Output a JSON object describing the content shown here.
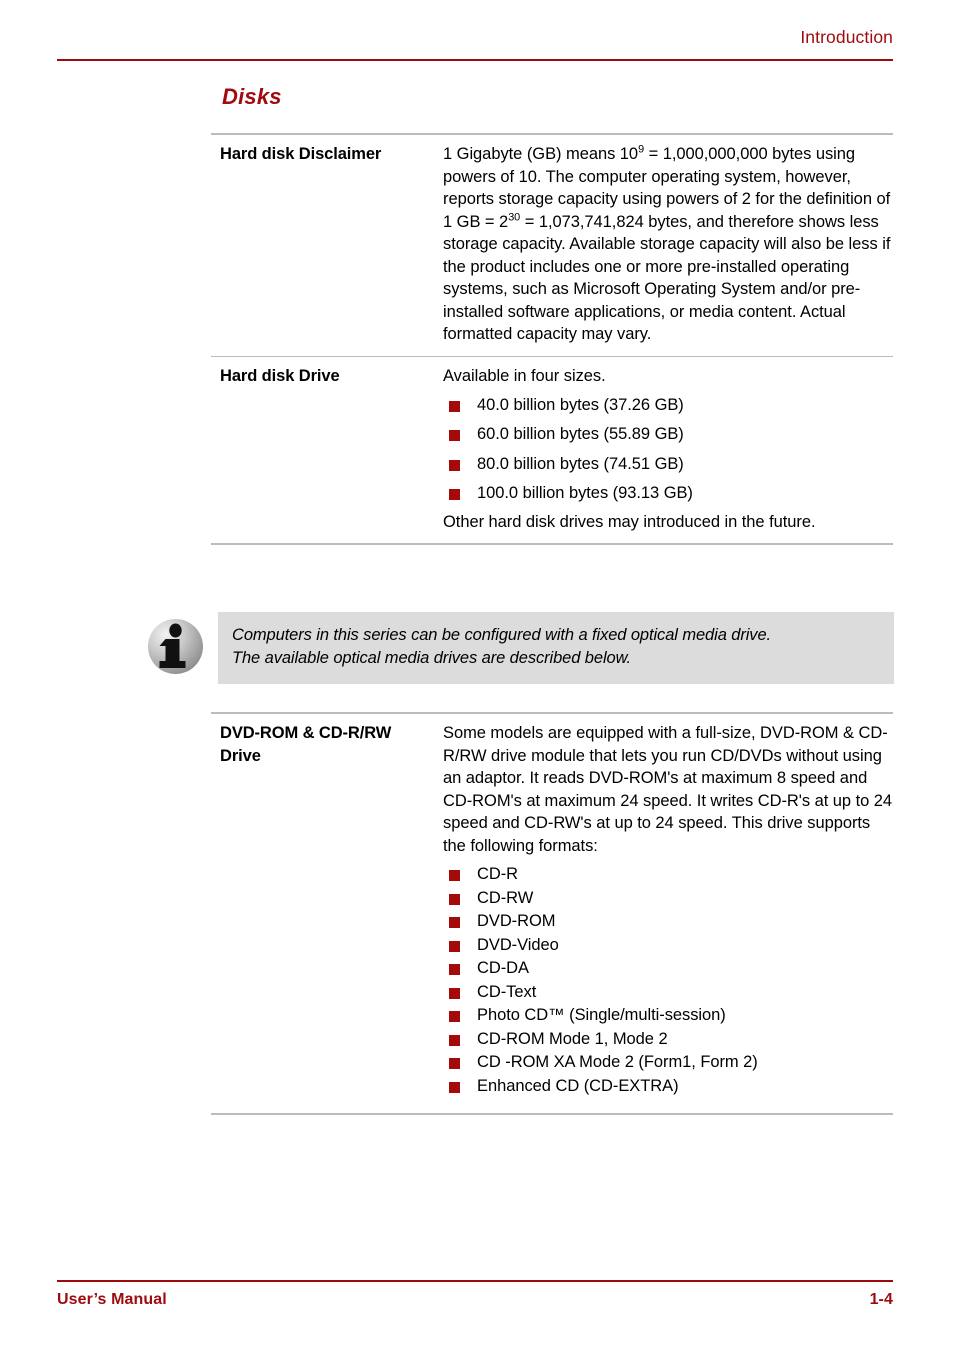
{
  "header": {
    "title": "Introduction",
    "accent_color": "#9e0b0f"
  },
  "section": {
    "title": "Disks",
    "title_color": "#a00b10"
  },
  "table": {
    "rows": [
      {
        "label": "Hard disk Disclaimer",
        "paragraph_prefix": "1 Gigabyte (GB) means 10",
        "sup1": "9",
        "paragraph_mid": " = 1,000,000,000 bytes using powers of 10. The computer operating system, however, reports storage capacity using powers of 2 for the definition of 1 GB = 2",
        "sup2": "30",
        "paragraph_suffix": " = 1,073,741,824 bytes, and therefore shows less storage capacity. Available storage capacity will also be less if the product includes one or more pre-installed operating systems, such as Microsoft Operating System and/or pre-installed software applications, or media content. Actual formatted capacity may vary."
      },
      {
        "label": "Hard disk Drive",
        "intro": "Available in four sizes.",
        "bullets": [
          "40.0 billion bytes (37.26 GB)",
          "60.0 billion bytes (55.89 GB)",
          "80.0 billion bytes (74.51 GB)",
          "100.0 billion bytes (93.13 GB)"
        ],
        "outro": "Other hard disk drives may introduced in the future."
      }
    ]
  },
  "note": {
    "icon": "info-icon",
    "text_line1": "Computers in this series can be configured with a fixed optical media drive.",
    "text_line2": "The available optical media drives are described below.",
    "background_color": "#dcdcdc"
  },
  "table2": {
    "rows": [
      {
        "label_line1": "DVD-ROM & CD-R/RW",
        "label_line2": "Drive",
        "paragraph": "Some models are equipped with a full-size, DVD-ROM & CD-R/RW drive module that lets you run CD/DVDs without using an adaptor. It reads DVD-ROM's at maximum 8 speed and CD-ROM's at maximum 24 speed. It writes CD-R's at up to 24 speed and CD-RW's at up to 24 speed. This drive supports the following formats:",
        "bullets": [
          "CD-R",
          "CD-RW",
          "DVD-ROM",
          "DVD-Video",
          "CD-DA",
          "CD-Text",
          "Photo CD™ (Single/multi-session)",
          "CD-ROM Mode 1, Mode 2",
          "CD -ROM XA Mode 2 (Form1, Form 2)",
          "Enhanced CD (CD-EXTRA)"
        ]
      }
    ]
  },
  "bullet_color": "#a50a0a",
  "footer": {
    "left": "User’s Manual",
    "right": "1-4",
    "accent_color": "#9e0b0f"
  }
}
